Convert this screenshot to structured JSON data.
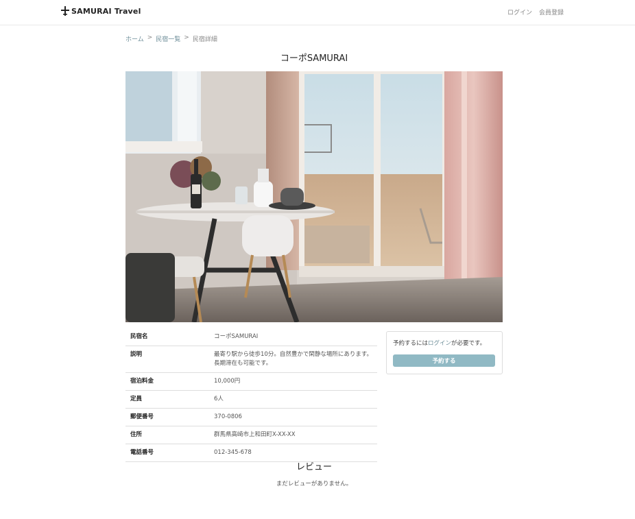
{
  "navbar": {
    "brand": "SAMURAI Travel",
    "login": "ログイン",
    "register": "会員登録"
  },
  "breadcrumb": {
    "home": "ホーム",
    "list": "民宿一覧",
    "current": "民宿詳細",
    "separator": ">"
  },
  "house": {
    "title": "コーポSAMURAI"
  },
  "details": [
    {
      "label": "民宿名",
      "value": "コーポSAMURAI"
    },
    {
      "label": "説明",
      "value": "最寄り駅から徒歩10分。自然豊かで閑静な場所にあります。長期滞在も可能です。"
    },
    {
      "label": "宿泊料金",
      "value": "10,000円"
    },
    {
      "label": "定員",
      "value": "6人"
    },
    {
      "label": "郵便番号",
      "value": "370-0806"
    },
    {
      "label": "住所",
      "value": "群馬県高崎市上和田町X-XX-XX"
    },
    {
      "label": "電話番号",
      "value": "012-345-678"
    }
  ],
  "reservation": {
    "text_before": "予約するには",
    "login_link": "ログイン",
    "text_after": "が必要です。",
    "button": "予約する"
  },
  "reviews": {
    "title": "レビュー",
    "empty": "まだレビューがありません。"
  },
  "colors": {
    "accent": "#90b9c4",
    "link": "#6f8f9a"
  }
}
